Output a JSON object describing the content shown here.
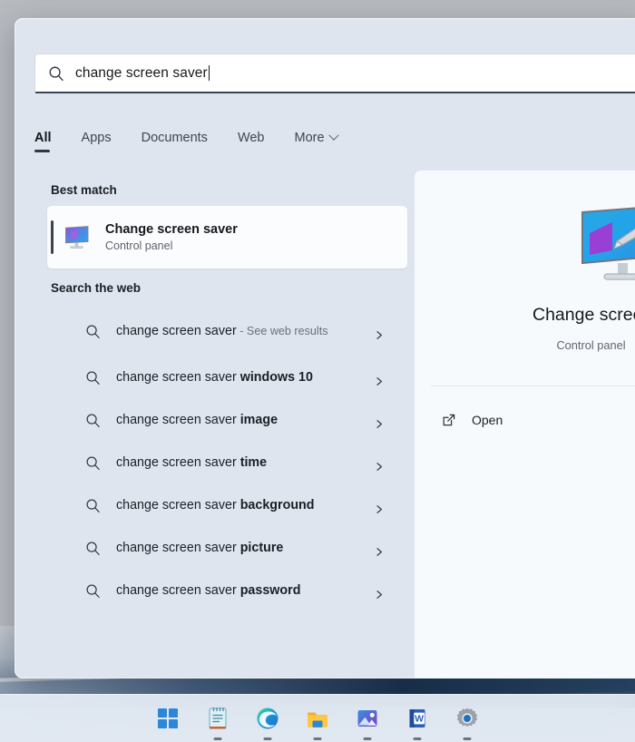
{
  "search": {
    "value": "change screen saver",
    "icon": "search-icon",
    "has_caret": true
  },
  "tabs": [
    {
      "label": "All",
      "active": true,
      "icon": null
    },
    {
      "label": "Apps",
      "active": false,
      "icon": null
    },
    {
      "label": "Documents",
      "active": false,
      "icon": null
    },
    {
      "label": "Web",
      "active": false,
      "icon": null
    },
    {
      "label": "More",
      "active": false,
      "icon": "chevron-down-icon"
    }
  ],
  "best_match": {
    "section_title": "Best match",
    "icon": "monitor-screensaver-icon",
    "title": "Change screen saver",
    "subtitle": "Control panel",
    "selected": true
  },
  "web": {
    "section_title": "Search the web",
    "items": [
      {
        "prefix": "change screen saver",
        "suffix": "",
        "trailing": " - See web results",
        "icon": "search-icon",
        "chevron": "chevron-right-icon",
        "two_line": true
      },
      {
        "prefix": "change screen saver ",
        "suffix": "windows 10",
        "trailing": "",
        "icon": "search-icon",
        "chevron": "chevron-right-icon",
        "two_line": false
      },
      {
        "prefix": "change screen saver ",
        "suffix": "image",
        "trailing": "",
        "icon": "search-icon",
        "chevron": "chevron-right-icon",
        "two_line": false
      },
      {
        "prefix": "change screen saver ",
        "suffix": "time",
        "trailing": "",
        "icon": "search-icon",
        "chevron": "chevron-right-icon",
        "two_line": false
      },
      {
        "prefix": "change screen saver ",
        "suffix": "background",
        "trailing": "",
        "icon": "search-icon",
        "chevron": "chevron-right-icon",
        "two_line": false
      },
      {
        "prefix": "change screen saver ",
        "suffix": "picture",
        "trailing": "",
        "icon": "search-icon",
        "chevron": "chevron-right-icon",
        "two_line": false
      },
      {
        "prefix": "change screen saver ",
        "suffix": "password",
        "trailing": "",
        "icon": "search-icon",
        "chevron": "chevron-right-icon",
        "two_line": false
      }
    ]
  },
  "preview": {
    "icon": "monitor-screensaver-large-icon",
    "title": "Change screen saver",
    "subtitle": "Control panel",
    "actions": [
      {
        "label": "Open",
        "icon": "open-external-icon"
      }
    ]
  },
  "taskbar": {
    "items": [
      {
        "name": "start",
        "label": "Start",
        "running": false
      },
      {
        "name": "notepad",
        "label": "Notepad",
        "running": true
      },
      {
        "name": "edge",
        "label": "Microsoft Edge",
        "running": true
      },
      {
        "name": "file-explorer",
        "label": "File Explorer",
        "running": true
      },
      {
        "name": "photos",
        "label": "Photos",
        "running": true
      },
      {
        "name": "word",
        "label": "Word",
        "running": true
      },
      {
        "name": "settings",
        "label": "Settings",
        "running": true
      }
    ]
  },
  "colors": {
    "panel_bg": "#dfe5ef",
    "preview_bg": "#f6fafd",
    "accent_underline": "#3b4654",
    "selection_bar": "#3c4350",
    "text_primary": "#15191e",
    "text_secondary": "#5d646d",
    "taskbar_bg": "#e4ecf5"
  }
}
